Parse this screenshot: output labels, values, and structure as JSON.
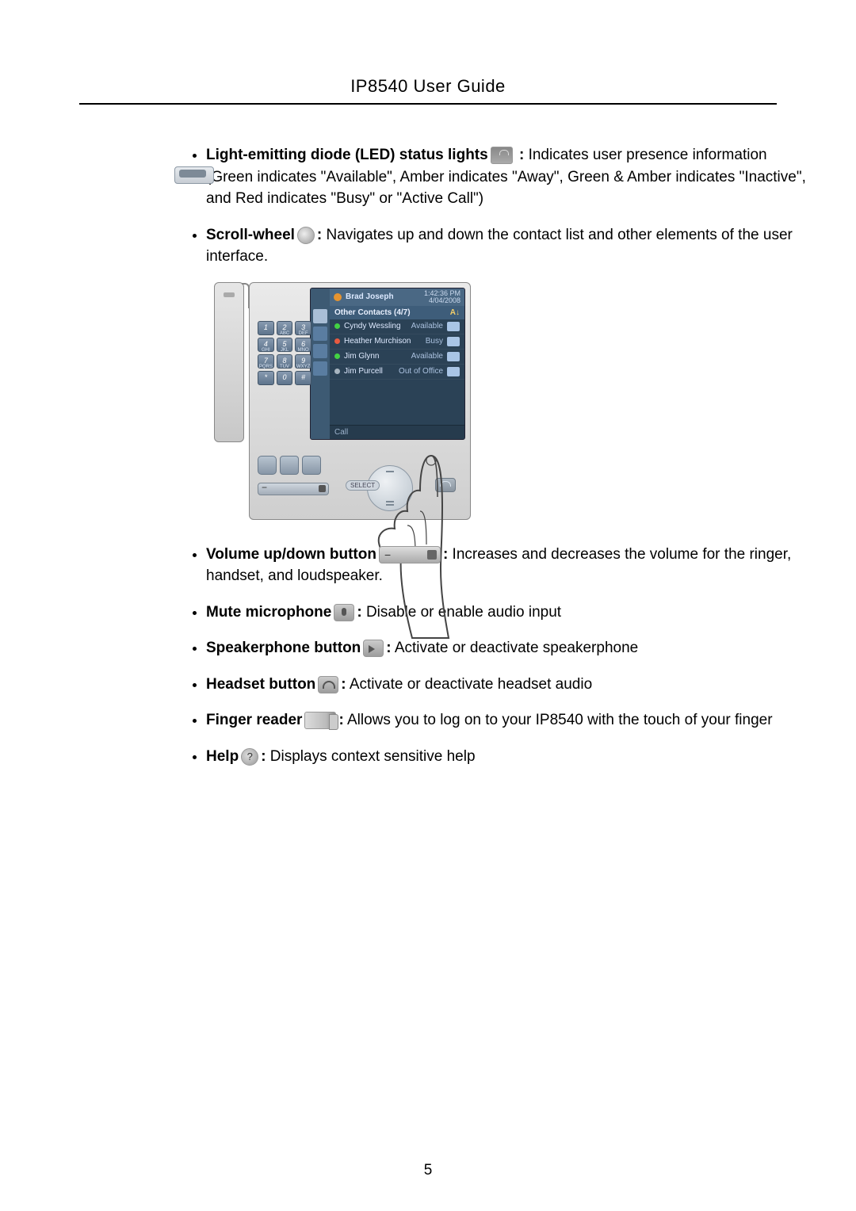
{
  "header": {
    "title": "IP8540 User Guide"
  },
  "bullets": {
    "led": {
      "label": "Light-emitting diode (LED) status lights",
      "desc": " Indicates user presence information (Green indicates \"Available\", Amber indicates \"Away\", Green & Amber indicates \"Inactive\", and Red indicates \"Busy\" or \"Active Call\")"
    },
    "scroll": {
      "label": "Scroll-wheel",
      "desc": " Navigates up and down the contact list and other elements of the user interface."
    },
    "volume": {
      "label": "Volume up/down button",
      "desc": " Increases and decreases the volume for the ringer, handset, and loudspeaker."
    },
    "mute": {
      "label": "Mute microphone",
      "desc": " Disable or enable audio input"
    },
    "speaker": {
      "label": "Speakerphone button",
      "desc": "  Activate or deactivate speakerphone"
    },
    "headset": {
      "label": "Headset button",
      "desc": "  Activate or deactivate headset audio"
    },
    "finger": {
      "label": "Finger reader",
      "desc": "  Allows you to log on to your IP8540 with the touch of your finger"
    },
    "help": {
      "label": "Help",
      "desc": " Displays context sensitive help"
    }
  },
  "phone_screen": {
    "user_name": "Brad Joseph",
    "time": "1:42:36 PM",
    "date": "4/04/2008",
    "section_title": "Other Contacts (4/7)",
    "sort_icon_label": "A↓",
    "contacts": [
      {
        "name": "Cyndy Wessling",
        "status": "Available",
        "presence": "p-green"
      },
      {
        "name": "Heather Murchison",
        "status": "Busy",
        "presence": "p-red"
      },
      {
        "name": "Jim Glynn",
        "status": "Available",
        "presence": "p-green"
      },
      {
        "name": "Jim Purcell",
        "status": "Out of Office",
        "presence": "p-grey"
      }
    ],
    "call_label": "Call"
  },
  "keypad": [
    {
      "d": "1",
      "s": ""
    },
    {
      "d": "2",
      "s": "ABC"
    },
    {
      "d": "3",
      "s": "DEF"
    },
    {
      "d": "4",
      "s": "GHI"
    },
    {
      "d": "5",
      "s": "JKL"
    },
    {
      "d": "6",
      "s": "MNO"
    },
    {
      "d": "7",
      "s": "PQRS"
    },
    {
      "d": "8",
      "s": "TUV"
    },
    {
      "d": "9",
      "s": "WXYZ"
    },
    {
      "d": "*",
      "s": ""
    },
    {
      "d": "0",
      "s": ""
    },
    {
      "d": "#",
      "s": ""
    }
  ],
  "scrollpad": {
    "select_label": "SELECT"
  },
  "page_number": "5"
}
